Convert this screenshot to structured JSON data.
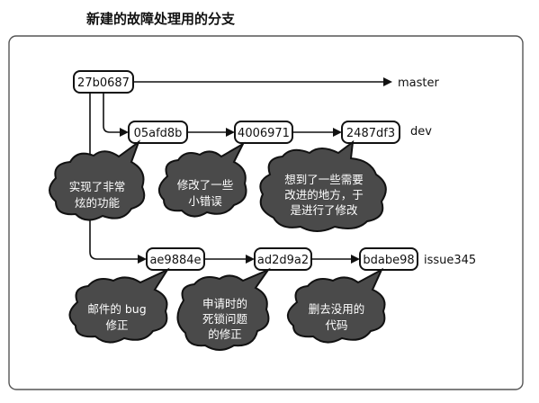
{
  "title": "新建的故障处理用的分支",
  "commits": {
    "c_27b": "27b0687",
    "c_05a": "05afd8b",
    "c_400": "4006971",
    "c_248": "2487df3",
    "c_ae9": "ae9884e",
    "c_ad2": "ad2d9a2",
    "c_bda": "bdabe98"
  },
  "branches": {
    "master": "master",
    "dev": "dev",
    "issue": "issue345"
  },
  "notes": {
    "n1": [
      "实现了非常",
      "炫的功能"
    ],
    "n2": [
      "修改了一些",
      "小错误"
    ],
    "n3": [
      "想到了一些需要",
      "改进的地方，于",
      "是进行了修改"
    ],
    "n4": [
      "邮件的 bug",
      "修正"
    ],
    "n5": [
      "申请时的",
      "死锁问题",
      "的修正"
    ],
    "n6": [
      "删去没用的",
      "代码"
    ]
  }
}
